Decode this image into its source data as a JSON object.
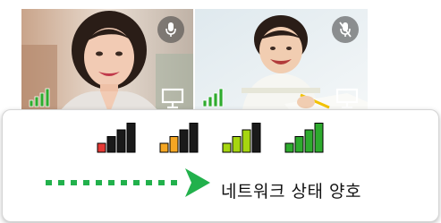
{
  "participants": [
    {
      "id": "participant-1",
      "network_level": 4,
      "mic": "on",
      "active_speaker": true
    },
    {
      "id": "participant-2",
      "network_level": 4,
      "mic": "muted",
      "active_speaker": false
    }
  ],
  "legend": {
    "signal_levels": [
      {
        "level": 1,
        "color": "#e53935"
      },
      {
        "level": 2,
        "color": "#f5a623"
      },
      {
        "level": 3,
        "color": "#a6d610"
      },
      {
        "level": 4,
        "color": "#2eab2e"
      }
    ],
    "caption": "네트워크 상태 양호",
    "arrow_color": "#22b14c"
  }
}
